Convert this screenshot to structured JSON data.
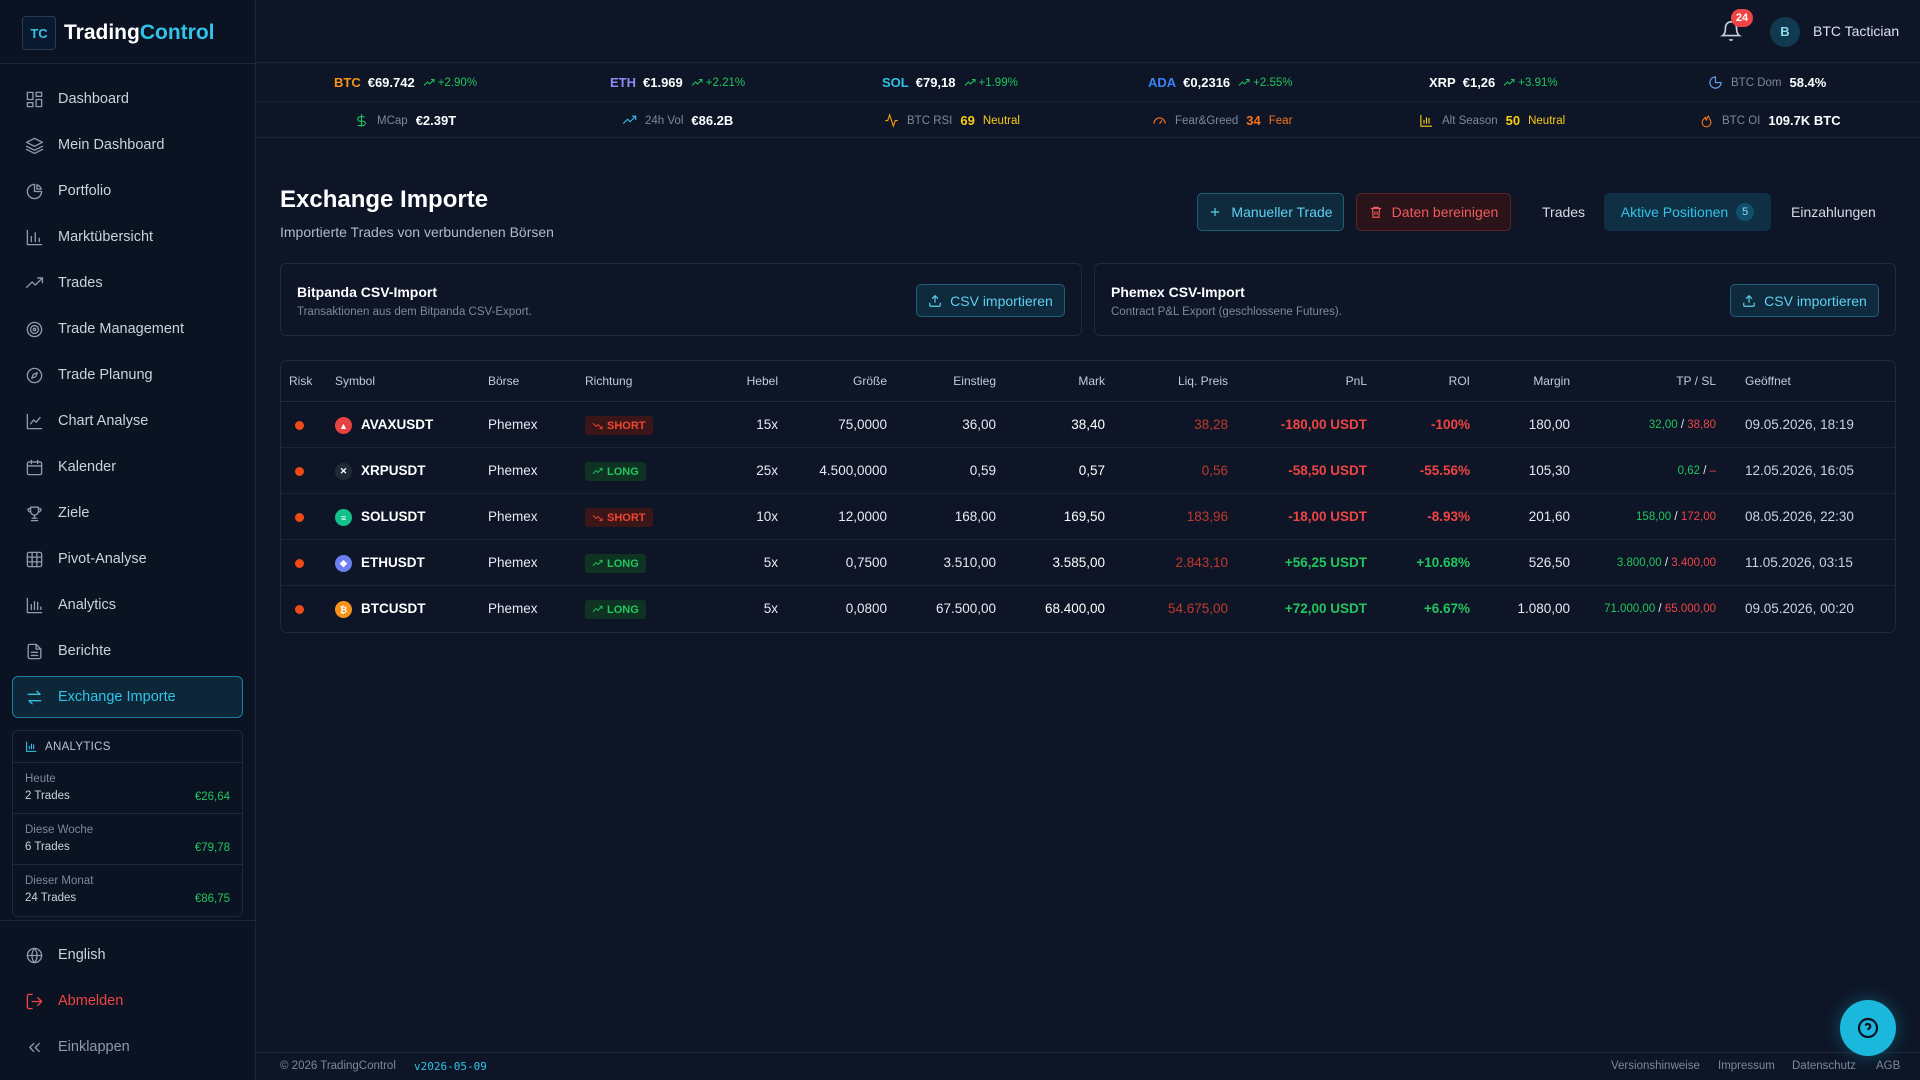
{
  "app": {
    "name_a": "Trading",
    "name_b": "Control",
    "logo_glyph": "TC"
  },
  "sidebar": {
    "items": [
      {
        "label": "Dashboard",
        "icon": "dashboard-icon"
      },
      {
        "label": "Mein Dashboard",
        "icon": "layers-icon"
      },
      {
        "label": "Portfolio",
        "icon": "pie-chart-icon"
      },
      {
        "label": "Marktübersicht",
        "icon": "bar-chart-icon"
      },
      {
        "label": "Trades",
        "icon": "trending-up-icon"
      },
      {
        "label": "Trade Management",
        "icon": "target-icon"
      },
      {
        "label": "Trade Planung",
        "icon": "compass-icon"
      },
      {
        "label": "Chart Analyse",
        "icon": "line-chart-icon"
      },
      {
        "label": "Kalender",
        "icon": "calendar-icon"
      },
      {
        "label": "Ziele",
        "icon": "trophy-icon"
      },
      {
        "label": "Pivot-Analyse",
        "icon": "grid-icon"
      },
      {
        "label": "Analytics",
        "icon": "analytics-icon"
      },
      {
        "label": "Berichte",
        "icon": "file-icon"
      },
      {
        "label": "Exchange Importe",
        "icon": "exchange-icon",
        "active": true
      }
    ],
    "analytics": {
      "title": "ANALYTICS",
      "rows": [
        {
          "period": "Heute",
          "trades": "2 Trades",
          "value": "€26,64"
        },
        {
          "period": "Diese Woche",
          "trades": "6 Trades",
          "value": "€79,78"
        },
        {
          "period": "Dieser Monat",
          "trades": "24 Trades",
          "value": "€86,75"
        }
      ]
    },
    "bottom": {
      "language": "English",
      "logout": "Abmelden",
      "collapse": "Einklappen"
    }
  },
  "topbar": {
    "notifications": "24",
    "avatar_letter": "B",
    "user": "BTC Tactician"
  },
  "ticker": {
    "coins": [
      {
        "sym": "BTC",
        "price": "€69.742",
        "chg": "+2.90%",
        "color": "#f7931a"
      },
      {
        "sym": "ETH",
        "price": "€1.969",
        "chg": "+2.21%",
        "color": "#8c8cf5"
      },
      {
        "sym": "SOL",
        "price": "€79,18",
        "chg": "+1.99%",
        "color": "#2fc3e8"
      },
      {
        "sym": "ADA",
        "price": "€0,2316",
        "chg": "+2.55%",
        "color": "#3b82f6"
      },
      {
        "sym": "XRP",
        "price": "€1,26",
        "chg": "+3.91%",
        "color": "#ffffff"
      }
    ],
    "btc_dom": {
      "label": "BTC Dom",
      "value": "58.4%"
    },
    "stats": [
      {
        "label": "MCap",
        "value": "€2.39T",
        "status": ""
      },
      {
        "label": "24h Vol",
        "value": "€86.2B",
        "status": ""
      },
      {
        "label": "BTC RSI",
        "value": "69",
        "status": "Neutral"
      },
      {
        "label": "Fear&Greed",
        "value": "34",
        "status": "Fear"
      },
      {
        "label": "Alt Season",
        "value": "50",
        "status": "Neutral"
      },
      {
        "label": "BTC OI",
        "value": "109.7K BTC",
        "status": ""
      }
    ]
  },
  "page": {
    "title": "Exchange Importe",
    "subtitle": "Importierte Trades von verbundenen Börsen",
    "btn_manual": "Manueller Trade",
    "btn_clean": "Daten bereinigen",
    "tabs": {
      "trades": "Trades",
      "aktive": "Aktive Positionen",
      "aktive_count": "5",
      "einzahlungen": "Einzahlungen"
    }
  },
  "imports": [
    {
      "title": "Bitpanda CSV-Import",
      "sub": "Transaktionen aus dem Bitpanda CSV-Export.",
      "btn": "CSV importieren"
    },
    {
      "title": "Phemex CSV-Import",
      "sub": "Contract P&L Export (geschlossene Futures).",
      "btn": "CSV importieren"
    }
  ],
  "table": {
    "headers": [
      "Risk",
      "Symbol",
      "Börse",
      "Richtung",
      "Hebel",
      "Größe",
      "Einstieg",
      "Mark",
      "Liq. Preis",
      "PnL",
      "ROI",
      "Margin",
      "TP / SL",
      "Geöffnet"
    ],
    "rows": [
      {
        "coin": "avax",
        "symbol": "AVAXUSDT",
        "exchange": "Phemex",
        "dir": "SHORT",
        "lev": "15x",
        "size": "75,0000",
        "entry": "36,00",
        "mark": "38,40",
        "liq": "38,28",
        "pnl": "-180,00 USDT",
        "roi": "-100%",
        "margin": "180,00",
        "tp": "32,00",
        "sl": "38,80",
        "opened": "09.05.2026, 18:19"
      },
      {
        "coin": "xrp",
        "symbol": "XRPUSDT",
        "exchange": "Phemex",
        "dir": "LONG",
        "lev": "25x",
        "size": "4.500,0000",
        "entry": "0,59",
        "mark": "0,57",
        "liq": "0,56",
        "pnl": "-58,50 USDT",
        "roi": "-55.56%",
        "margin": "105,30",
        "tp": "0,62",
        "sl": "–",
        "opened": "12.05.2026, 16:05"
      },
      {
        "coin": "sol",
        "symbol": "SOLUSDT",
        "exchange": "Phemex",
        "dir": "SHORT",
        "lev": "10x",
        "size": "12,0000",
        "entry": "168,00",
        "mark": "169,50",
        "liq": "183,96",
        "pnl": "-18,00 USDT",
        "roi": "-8.93%",
        "margin": "201,60",
        "tp": "158,00",
        "sl": "172,00",
        "opened": "08.05.2026, 22:30"
      },
      {
        "coin": "eth",
        "symbol": "ETHUSDT",
        "exchange": "Phemex",
        "dir": "LONG",
        "lev": "5x",
        "size": "0,7500",
        "entry": "3.510,00",
        "mark": "3.585,00",
        "liq": "2.843,10",
        "pnl": "+56,25 USDT",
        "roi": "+10.68%",
        "margin": "526,50",
        "tp": "3.800,00",
        "sl": "3.400,00",
        "opened": "11.05.2026, 03:15"
      },
      {
        "coin": "btc",
        "symbol": "BTCUSDT",
        "exchange": "Phemex",
        "dir": "LONG",
        "lev": "5x",
        "size": "0,0800",
        "entry": "67.500,00",
        "mark": "68.400,00",
        "liq": "54.675,00",
        "pnl": "+72,00 USDT",
        "roi": "+6.67%",
        "margin": "1.080,00",
        "tp": "71.000,00",
        "sl": "65.000,00",
        "opened": "09.05.2026, 00:20"
      }
    ]
  },
  "footer": {
    "copyright": "© 2026 TradingControl",
    "version": "v2026-05-09",
    "links": [
      "Versionshinweise",
      "Impressum",
      "Datenschutz",
      "AGB"
    ]
  }
}
